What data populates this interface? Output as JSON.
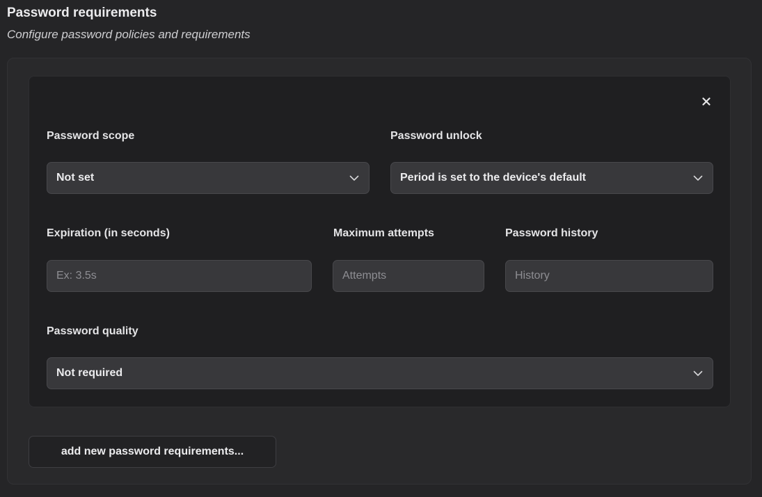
{
  "section": {
    "title": "Password requirements",
    "subtitle": "Configure password policies and requirements"
  },
  "card": {
    "close_icon": "close-icon",
    "password_scope": {
      "label": "Password scope",
      "value": "Not set"
    },
    "password_unlock": {
      "label": "Password unlock",
      "value": "Period is set to the device's default"
    },
    "expiration": {
      "label": "Expiration (in seconds)",
      "placeholder": "Ex: 3.5s",
      "value": ""
    },
    "max_attempts": {
      "label": "Maximum attempts",
      "placeholder": "Attempts",
      "value": ""
    },
    "password_history": {
      "label": "Password history",
      "placeholder": "History",
      "value": ""
    },
    "password_quality": {
      "label": "Password quality",
      "value": "Not required"
    }
  },
  "add_button": {
    "label": "add new password requirements..."
  },
  "colors": {
    "background": "#252527",
    "panel": "#29292b",
    "card": "#1f1f21",
    "control": "#38383b",
    "text": "#ececee",
    "placeholder": "#8e8e93"
  }
}
